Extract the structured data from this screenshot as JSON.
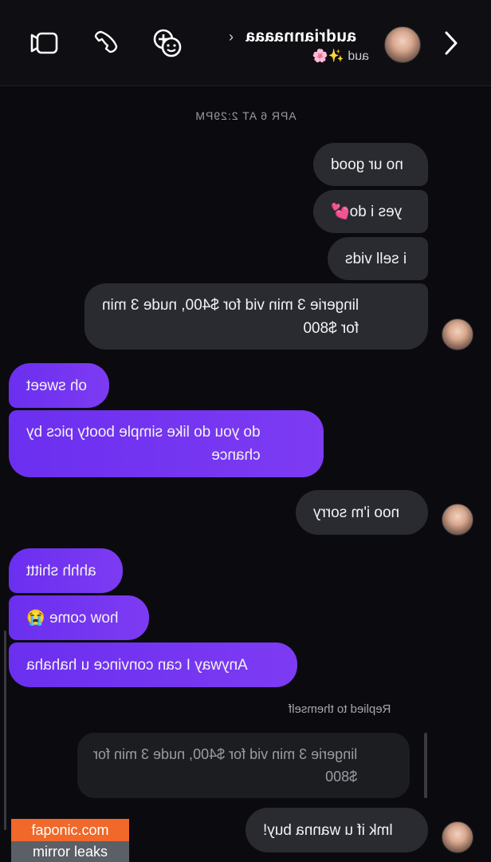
{
  "header": {
    "username": "audriannaaaa",
    "subname": "aud ✨🌸",
    "icons": [
      "back-chevron-icon",
      "video-call-icon",
      "phone-icon",
      "sticker-add-icon"
    ]
  },
  "timestamp": "APR 6 AT 2:29PM",
  "messages": [
    {
      "dir": "in",
      "text": "no ur good"
    },
    {
      "dir": "in",
      "text": "yes i do💕"
    },
    {
      "dir": "in",
      "text": "i sell vids"
    },
    {
      "dir": "in",
      "text": "lingerie 3 min vid for $400, nude 3 min\nfor $800"
    },
    {
      "dir": "out",
      "text": "oh sweet"
    },
    {
      "dir": "out",
      "text": "do you do like simple booty pics by\nchance"
    },
    {
      "dir": "in",
      "text": "noo i'm sorry"
    },
    {
      "dir": "out",
      "text": "ahhh shittt"
    },
    {
      "dir": "out",
      "text": "how come 😭"
    },
    {
      "dir": "out",
      "text": "Anyway I can convince u hahaha"
    },
    {
      "dir": "in",
      "text": "lmk if u wanna buy!"
    }
  ],
  "reply": {
    "label": "Replied to themself",
    "quoted": "lingerie 3 min vid for $400, nude 3 min for\n$800"
  },
  "watermark": {
    "top": "faponic.com",
    "bottom": "mirror leaks"
  },
  "colors": {
    "background": "#0b0b0f",
    "incoming_bubble": "#2a2b30",
    "outgoing_bubble": "#7437f1",
    "watermark_orange": "#f0682a"
  }
}
